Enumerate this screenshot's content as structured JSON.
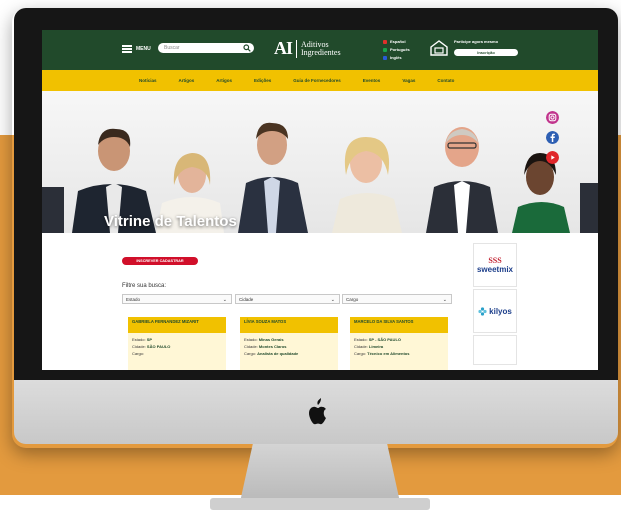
{
  "topbar": {
    "menu_label": "MENU",
    "search_placeholder": "Buscar",
    "logo": {
      "mark": "AI",
      "line1": "Aditivos",
      "line2": "Ingredientes"
    },
    "languages": [
      {
        "label": "Español",
        "color": "#e0302b"
      },
      {
        "label": "Português",
        "color": "#19a34a"
      },
      {
        "label": "Inglês",
        "color": "#2a5bd7"
      }
    ],
    "register": {
      "label": "Participe agora mesmo",
      "button": "Inscrição"
    }
  },
  "nav": {
    "items": [
      "Notícias",
      "Artigos",
      "Artigos",
      "Edições",
      "Guia de Fornecedores",
      "Eventos",
      "Vagas",
      "Contato"
    ]
  },
  "hero": {
    "title": "Vitrine de Talentos"
  },
  "content": {
    "register_button": "INSCREVER CADASTRAR",
    "filter_label": "Filtre sua busca:",
    "selects": [
      {
        "value": "Estado"
      },
      {
        "value": "Cidade"
      },
      {
        "value": "Cargo"
      }
    ],
    "cards": [
      {
        "name": "GABRIELA FERNANDEZ MIZARIT",
        "lines": [
          [
            "Estado:",
            "SP"
          ],
          [
            "Cidade:",
            "SÃO PAULO"
          ],
          [
            "Cargo:",
            ""
          ]
        ]
      },
      {
        "name": "LÍVIA SOUZA MATOS",
        "lines": [
          [
            "Estado:",
            "Minas Gerais"
          ],
          [
            "Cidade:",
            "Montes Claros"
          ],
          [
            "Cargo:",
            "Analista de qualidade"
          ]
        ]
      },
      {
        "name": "MARCELO DA SILVA SANTOS",
        "lines": [
          [
            "Estado:",
            "SP - SÃO PAULO"
          ],
          [
            "Cidade:",
            "Limeira"
          ],
          [
            "Cargo:",
            "Técnico em Alimentos"
          ]
        ]
      }
    ]
  },
  "sponsors": [
    {
      "name": "sweetmix",
      "mark": "SSS"
    },
    {
      "name": "kilyos"
    }
  ],
  "colors": {
    "brand_green": "#214a2b",
    "brand_yellow": "#f1c100",
    "background_orange": "#e39a3e",
    "accent_red": "#d10f2a"
  }
}
